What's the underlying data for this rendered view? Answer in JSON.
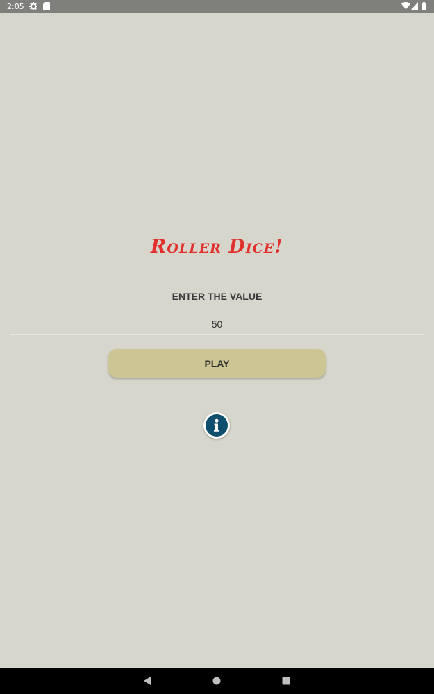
{
  "status_bar": {
    "time": "2:05",
    "icons": [
      "gear-icon",
      "sd-card-icon",
      "wifi-icon",
      "cell-signal-icon",
      "battery-icon"
    ]
  },
  "app": {
    "title": "Roller Dice!",
    "input_label": "ENTER THE VALUE",
    "input_value": "50",
    "play_label": "PLAY",
    "info_icon": "info-icon"
  },
  "nav_bar": {
    "icons": [
      "back-icon",
      "home-icon",
      "recents-icon"
    ]
  },
  "colors": {
    "background": "#d7d6cc",
    "title": "#e0312d",
    "play_button": "#cdc594",
    "info_icon": "#0e4f6e",
    "status_bar": "#7f7f7b",
    "nav_bar": "#000000"
  }
}
